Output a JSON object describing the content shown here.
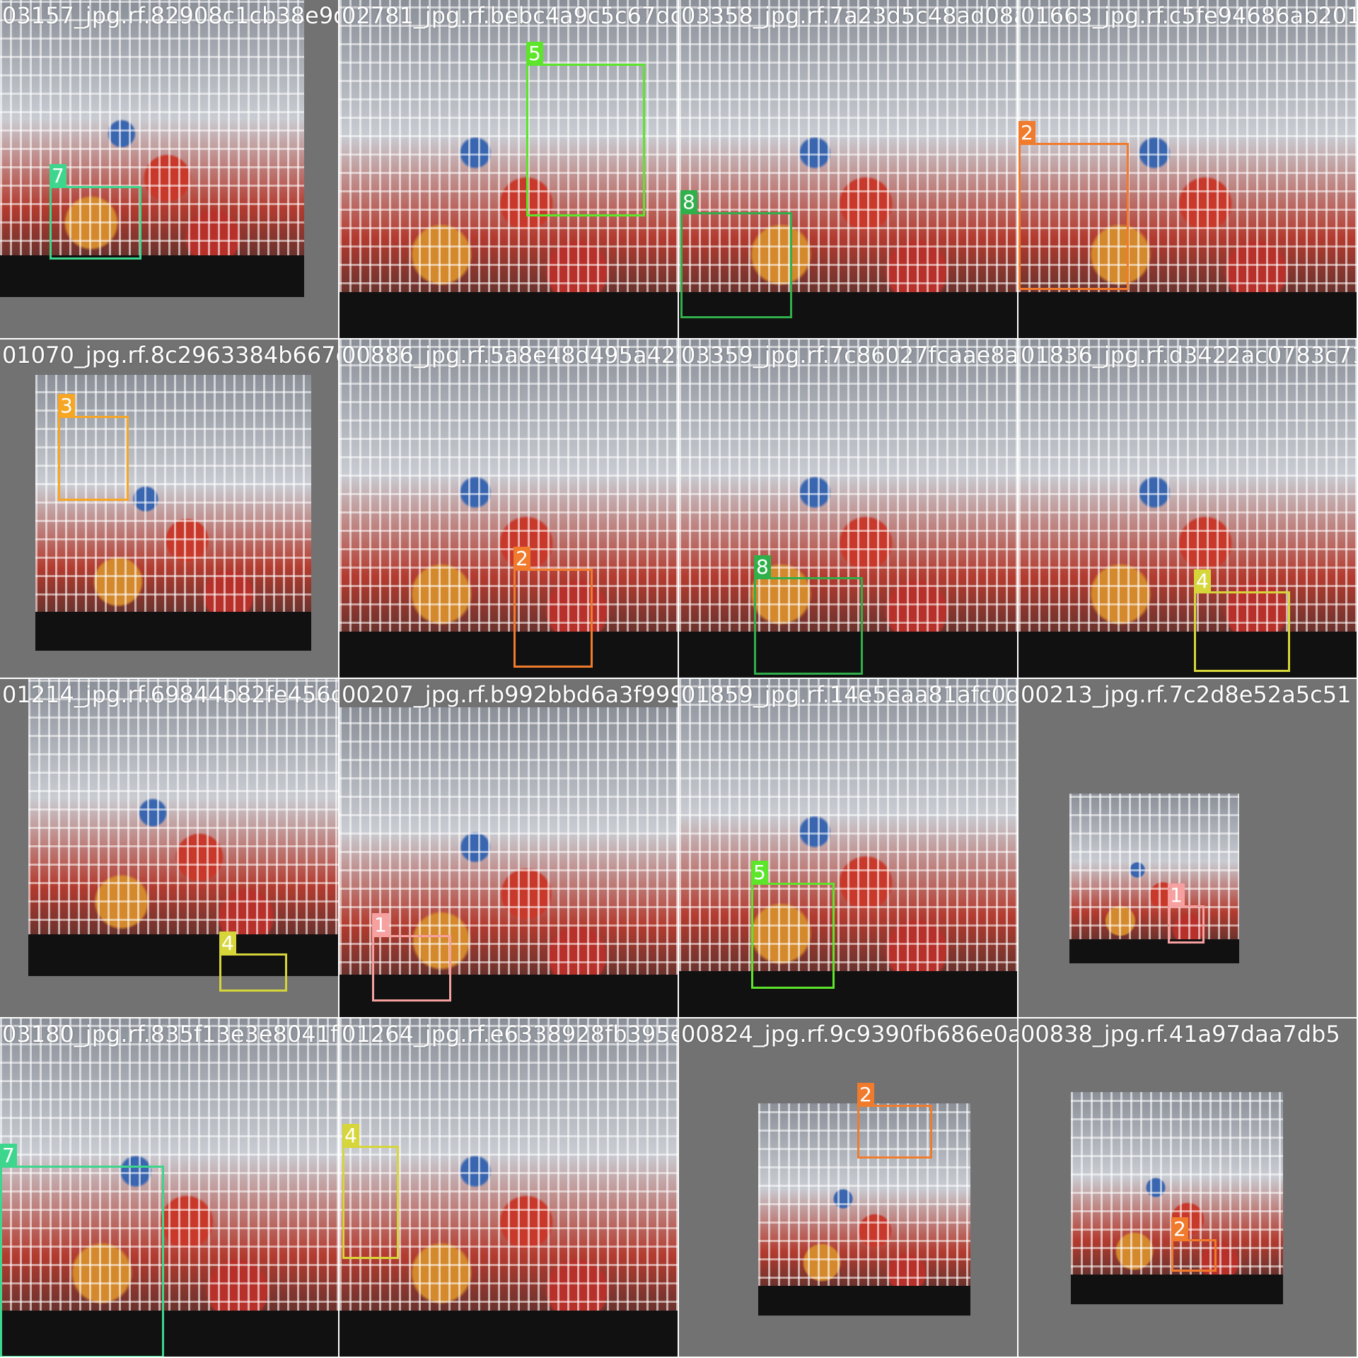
{
  "mosaic": {
    "tiles": [
      {
        "filename": "03157_jpg.rf.82908c1cb38e9d788",
        "boxes": [
          {
            "class_id": "7",
            "color": "#3dd68c"
          }
        ]
      },
      {
        "filename": "02781_jpg.rf.bebc4a9c5c67dc9d33",
        "boxes": [
          {
            "class_id": "5",
            "color": "#5ce52a"
          }
        ]
      },
      {
        "filename": "03358_jpg.rf.7a23d5c48ad08a0892",
        "boxes": [
          {
            "class_id": "8",
            "color": "#2fb04a"
          }
        ]
      },
      {
        "filename": "01663_jpg.rf.c5fe94686ab2012",
        "boxes": [
          {
            "class_id": "2",
            "color": "#f07b2c"
          }
        ]
      },
      {
        "filename": "01070_jpg.rf.8c2963384b667d9e8",
        "boxes": [
          {
            "class_id": "3",
            "color": "#f6a623"
          }
        ]
      },
      {
        "filename": "00886_jpg.rf.5a8e48d495a42d35",
        "boxes": [
          {
            "class_id": "2",
            "color": "#f07b2c"
          }
        ]
      },
      {
        "filename": "03359_jpg.rf.7c86027fcaae8a483",
        "boxes": [
          {
            "class_id": "8",
            "color": "#2fb04a"
          }
        ]
      },
      {
        "filename": "01836_jpg.rf.d3422ac0783c715",
        "boxes": [
          {
            "class_id": "4",
            "color": "#d6d63a"
          }
        ]
      },
      {
        "filename": "01214_jpg.rf.69844b82fe456d7818",
        "boxes": [
          {
            "class_id": "4",
            "color": "#d6d63a"
          }
        ]
      },
      {
        "filename": "00207_jpg.rf.b992bbd6a3f9992d25",
        "boxes": [
          {
            "class_id": "1",
            "color": "#f7a0a0"
          }
        ]
      },
      {
        "filename": "01859_jpg.rf.14e5eaa81afc0d21",
        "boxes": [
          {
            "class_id": "5",
            "color": "#5ce52a"
          }
        ]
      },
      {
        "filename": "00213_jpg.rf.7c2d8e52a5c51",
        "boxes": [
          {
            "class_id": "1",
            "color": "#f7a0a0"
          }
        ]
      },
      {
        "filename": "03180_jpg.rf.835f13e3e8041f34f",
        "boxes": [
          {
            "class_id": "7",
            "color": "#3dd68c"
          }
        ]
      },
      {
        "filename": "01264_jpg.rf.e6338928fb395e7009",
        "boxes": [
          {
            "class_id": "4",
            "color": "#d6d63a"
          }
        ]
      },
      {
        "filename": "00824_jpg.rf.9c9390fb686e0a28",
        "boxes": [
          {
            "class_id": "2",
            "color": "#f07b2c"
          }
        ]
      },
      {
        "filename": "00838_jpg.rf.41a97daa7db5",
        "boxes": [
          {
            "class_id": "2",
            "color": "#f07b2c"
          }
        ]
      }
    ]
  }
}
